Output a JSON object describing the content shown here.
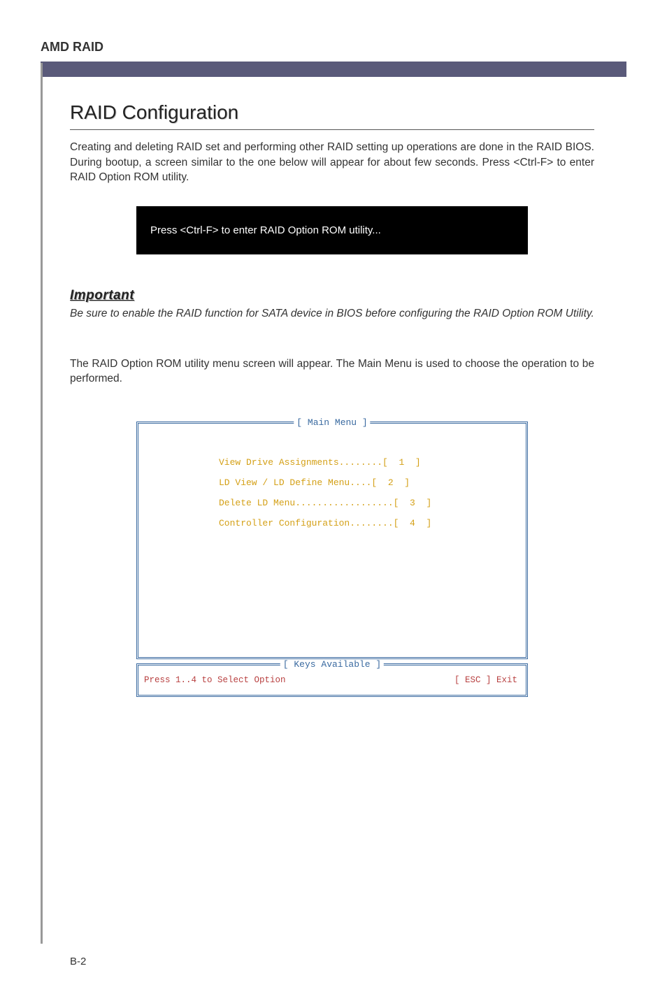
{
  "header": {
    "title": "AMD RAID"
  },
  "section": {
    "title": "RAID Configuration",
    "intro": "Creating and deleting RAID set and performing other RAID setting up operations are done in the RAID BIOS. During bootup, a screen similar to the one below will appear for about few seconds. Press <Ctrl-F> to enter RAID Option ROM utility."
  },
  "blackbox": {
    "text": "Press <Ctrl-F> to enter RAID Option ROM utility..."
  },
  "important": {
    "label": "Important",
    "text": "Be sure to enable the RAID function for SATA device in BIOS before configuring the RAID Option ROM Utility."
  },
  "post": {
    "text": "The RAID Option ROM utility menu screen will appear. The Main Menu is used to choose the operation to be performed."
  },
  "bios": {
    "main_title": "[ Main Menu ]",
    "keys_title": "[ Keys Available ]",
    "items": {
      "item1": "View Drive Assignments........[  1  ]",
      "item2": "LD View / LD Define Menu....[  2  ]",
      "item3": "Delete LD Menu..................[  3  ]",
      "item4": "Controller Configuration........[  4  ]"
    },
    "keys_left": "Press 1..4 to Select Option",
    "keys_right": "[ ESC ]  Exit"
  },
  "footer": {
    "page": "B-2"
  }
}
